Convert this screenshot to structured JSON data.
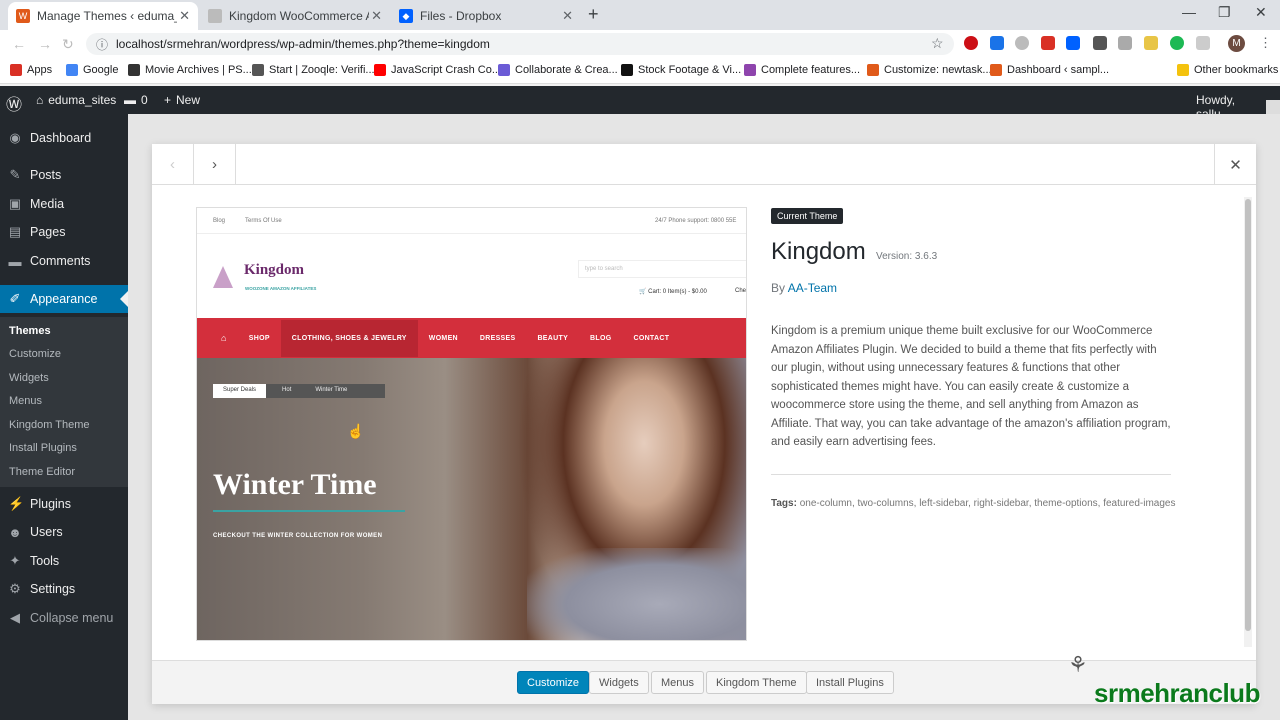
{
  "browser": {
    "tabs": [
      {
        "title": "Manage Themes ‹ eduma_sites —",
        "favicon_color": "#e05a1a",
        "active": true
      },
      {
        "title": "Kingdom WooCommerce Amazo",
        "favicon_color": "#999999",
        "active": false
      },
      {
        "title": "Files - Dropbox",
        "favicon_color": "#0061ff",
        "active": false
      }
    ],
    "url": "localhost/srmehran/wordpress/wp-admin/themes.php?theme=kingdom",
    "profile_initial": "M",
    "bookmarks": [
      {
        "label": "Apps",
        "color": "#d93025"
      },
      {
        "label": "Google",
        "color": "#4285f4"
      },
      {
        "label": "Movie Archives | PS...",
        "color": "#333333"
      },
      {
        "label": "Start | Zooqle: Verifi...",
        "color": "#555555"
      },
      {
        "label": "JavaScript Crash Co...",
        "color": "#ff0000"
      },
      {
        "label": "Collaborate & Crea...",
        "color": "#6b5bd6"
      },
      {
        "label": "Stock Footage & Vi...",
        "color": "#111111"
      },
      {
        "label": "Complete features...",
        "color": "#8e44ad"
      },
      {
        "label": "Customize: newtask...",
        "color": "#e05a1a"
      },
      {
        "label": "Dashboard ‹ sampl...",
        "color": "#e05a1a"
      },
      {
        "label": "Other bookmarks",
        "color": "#f4c20d"
      }
    ]
  },
  "adminbar": {
    "site_name": "eduma_sites",
    "comments_count": "0",
    "new_label": "New",
    "howdy": "Howdy, sallu"
  },
  "sidebar": {
    "items": [
      {
        "label": "Dashboard",
        "icon": "dashboard-icon",
        "glyph": "◉"
      },
      {
        "label": "Posts",
        "icon": "pin-icon",
        "glyph": "✎"
      },
      {
        "label": "Media",
        "icon": "media-icon",
        "glyph": "▣"
      },
      {
        "label": "Pages",
        "icon": "pages-icon",
        "glyph": "▤"
      },
      {
        "label": "Comments",
        "icon": "comment-icon",
        "glyph": "▬"
      },
      {
        "label": "Appearance",
        "icon": "paintbrush-icon",
        "glyph": "✐"
      }
    ],
    "submenu": [
      "Themes",
      "Customize",
      "Widgets",
      "Menus",
      "Kingdom Theme",
      "Install Plugins",
      "Theme Editor"
    ],
    "lower_items": [
      {
        "label": "Plugins",
        "icon": "plugin-icon",
        "glyph": "⚡"
      },
      {
        "label": "Users",
        "icon": "users-icon",
        "glyph": "☻"
      },
      {
        "label": "Tools",
        "icon": "wrench-icon",
        "glyph": "✦"
      },
      {
        "label": "Settings",
        "icon": "settings-icon",
        "glyph": "⚙"
      },
      {
        "label": "Collapse menu",
        "icon": "collapse-icon",
        "glyph": "◀"
      }
    ]
  },
  "screenshot": {
    "topbar_left": [
      "Blog",
      "Terms Of Use"
    ],
    "topbar_right": "24/7 Phone support: 0800 55E",
    "logo": "Kingdom",
    "logo_sub": "WOOZONE AMAZON AFFILIATES",
    "search_placeholder": "type to search",
    "cart": "Cart: 0 Item(s) - $0.00",
    "checkout": "Che",
    "nav": [
      "SHOP",
      "CLOTHING, SHOES & JEWELRY",
      "WOMEN",
      "DRESSES",
      "BEAUTY",
      "BLOG",
      "CONTACT"
    ],
    "hero_tabs": [
      "Super Deals",
      "Hot",
      "Winter Time"
    ],
    "hero_title": "Winter Time",
    "hero_sub": "CHECKOUT THE WINTER COLLECTION FOR WOMEN"
  },
  "theme": {
    "badge": "Current Theme",
    "name": "Kingdom",
    "version": "Version: 3.6.3",
    "by": "By",
    "author": "AA-Team",
    "description": "Kingdom is a premium unique theme built exclusive for our WooCommerce Amazon Affiliates Plugin. We decided to build a theme that fits perfectly with our plugin, without using unnecessary features & functions that other sophisticated themes might have. You can easily create & customize a woocommerce store using the theme, and sell anything from Amazon as Affiliate. That way, you can take advantage of the amazon's affiliation program, and easily earn advertising fees.",
    "tags_label": "Tags:",
    "tags": "one-column, two-columns, left-sidebar, right-sidebar, theme-options, featured-images"
  },
  "footer_buttons": [
    "Customize",
    "Widgets",
    "Menus",
    "Kingdom Theme",
    "Install Plugins"
  ],
  "watermark": "srmehranclub"
}
